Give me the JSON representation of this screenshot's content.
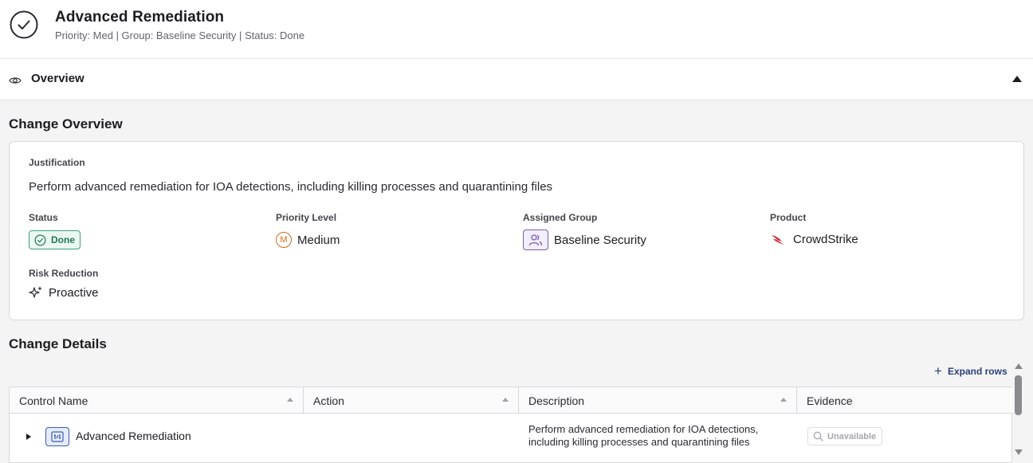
{
  "header": {
    "title": "Advanced Remediation",
    "subtitle": "Priority: Med | Group: Baseline Security | Status: Done",
    "icon": "check-circle-icon"
  },
  "overview_bar": {
    "label": "Overview",
    "icon": "eye-icon",
    "toggle_icon": "caret-up-icon"
  },
  "change_overview": {
    "title": "Change Overview",
    "justification_label": "Justification",
    "justification_text": "Perform advanced remediation for IOA detections, including killing processes and quarantining files",
    "status_label": "Status",
    "status_value": "Done",
    "priority_label": "Priority Level",
    "priority_letter": "M",
    "priority_value": "Medium",
    "group_label": "Assigned Group",
    "group_value": "Baseline Security",
    "product_label": "Product",
    "product_value": "CrowdStrike",
    "risk_label": "Risk Reduction",
    "risk_value": "Proactive"
  },
  "change_details": {
    "title": "Change Details",
    "expand_rows": "Expand rows",
    "columns": [
      "Control Name",
      "Action",
      "Description",
      "Evidence"
    ],
    "rows": [
      {
        "control_name": "Advanced Remediation",
        "action": "",
        "description": "Perform advanced remediation for IOA detections, including killing processes and quarantining files",
        "evidence": "Unavailable"
      }
    ]
  },
  "colors": {
    "status_done": "#1e7a55",
    "priority_medium": "#d2691e",
    "group_accent": "#7b5bb5",
    "crowdstrike_red": "#d6202e",
    "link": "#2c3e7a"
  }
}
